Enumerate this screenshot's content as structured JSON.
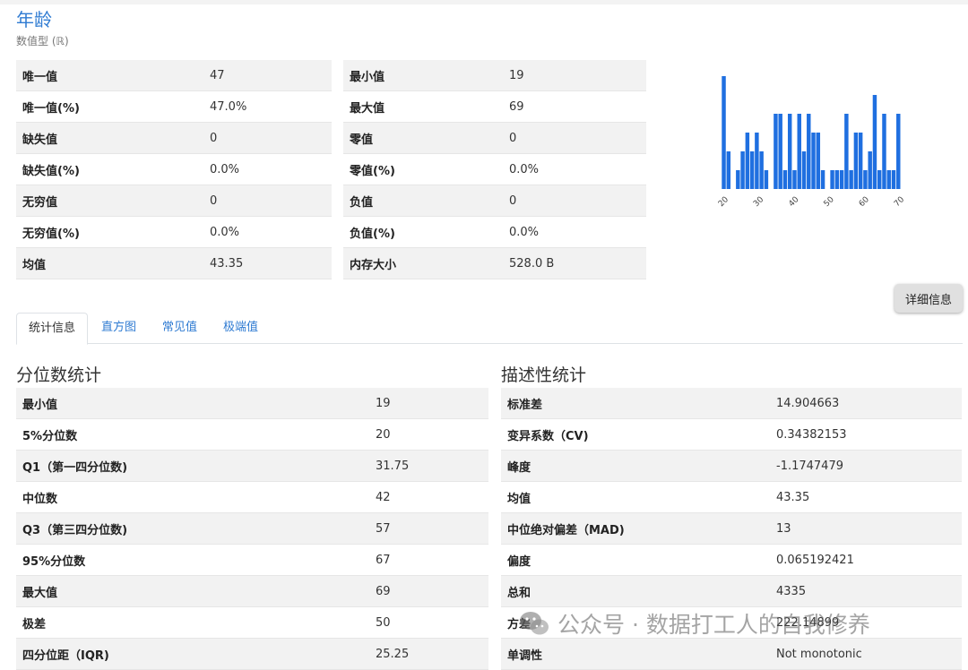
{
  "header": {
    "title": "年龄",
    "subtitle": "数值型 (ℝ)"
  },
  "summary_left": [
    {
      "label": "唯一值",
      "value": "47"
    },
    {
      "label": "唯一值(%)",
      "value": "47.0%"
    },
    {
      "label": "缺失值",
      "value": "0"
    },
    {
      "label": "缺失值(%)",
      "value": "0.0%"
    },
    {
      "label": "无穷值",
      "value": "0"
    },
    {
      "label": "无穷值(%)",
      "value": "0.0%"
    },
    {
      "label": "均值",
      "value": "43.35"
    }
  ],
  "summary_right": [
    {
      "label": "最小值",
      "value": "19"
    },
    {
      "label": "最大值",
      "value": "69"
    },
    {
      "label": "零值",
      "value": "0"
    },
    {
      "label": "零值(%)",
      "value": "0.0%"
    },
    {
      "label": "负值",
      "value": "0"
    },
    {
      "label": "负值(%)",
      "value": "0.0%"
    },
    {
      "label": "内存大小",
      "value": "528.0 B"
    }
  ],
  "chart_data": {
    "type": "bar",
    "x_ticks": [
      "20",
      "30",
      "40",
      "50",
      "60",
      "70"
    ],
    "x_range": [
      19,
      69
    ],
    "bar_color": "#1f6fe0",
    "values": [
      6,
      2,
      0,
      1,
      2,
      3,
      2,
      3,
      2,
      1,
      0,
      4,
      4,
      1,
      4,
      1,
      4,
      2,
      4,
      3,
      3,
      1,
      0,
      1,
      1,
      1,
      4,
      1,
      3,
      3,
      1,
      2,
      5,
      1,
      4,
      1,
      1,
      4
    ]
  },
  "detail_button": {
    "label": "详细信息"
  },
  "tabs": [
    {
      "label": "统计信息",
      "active": true
    },
    {
      "label": "直方图",
      "active": false
    },
    {
      "label": "常见值",
      "active": false
    },
    {
      "label": "极端值",
      "active": false
    }
  ],
  "quantile": {
    "title": "分位数统计",
    "rows": [
      {
        "label": "最小值",
        "value": "19"
      },
      {
        "label": "5%分位数",
        "value": "20"
      },
      {
        "label": "Q1（第一四分位数)",
        "value": "31.75"
      },
      {
        "label": "中位数",
        "value": "42"
      },
      {
        "label": "Q3（第三四分位数)",
        "value": "57"
      },
      {
        "label": "95%分位数",
        "value": "67"
      },
      {
        "label": "最大值",
        "value": "69"
      },
      {
        "label": "极差",
        "value": "50"
      },
      {
        "label": "四分位距（IQR)",
        "value": "25.25"
      }
    ]
  },
  "descriptive": {
    "title": "描述性统计",
    "rows": [
      {
        "label": "标准差",
        "value": "14.904663"
      },
      {
        "label": "变异系数（CV)",
        "value": "0.34382153"
      },
      {
        "label": "峰度",
        "value": "-1.1747479"
      },
      {
        "label": "均值",
        "value": "43.35"
      },
      {
        "label": "中位绝对偏差（MAD)",
        "value": "13"
      },
      {
        "label": "偏度",
        "value": "0.065192421"
      },
      {
        "label": "总和",
        "value": "4335"
      },
      {
        "label": "方差",
        "value": "222.14899"
      },
      {
        "label": "单调性",
        "value": "Not monotonic"
      }
    ]
  },
  "watermark": {
    "text": "公众号 · 数据打工人的自我修养",
    "icon": "wechat-icon"
  }
}
